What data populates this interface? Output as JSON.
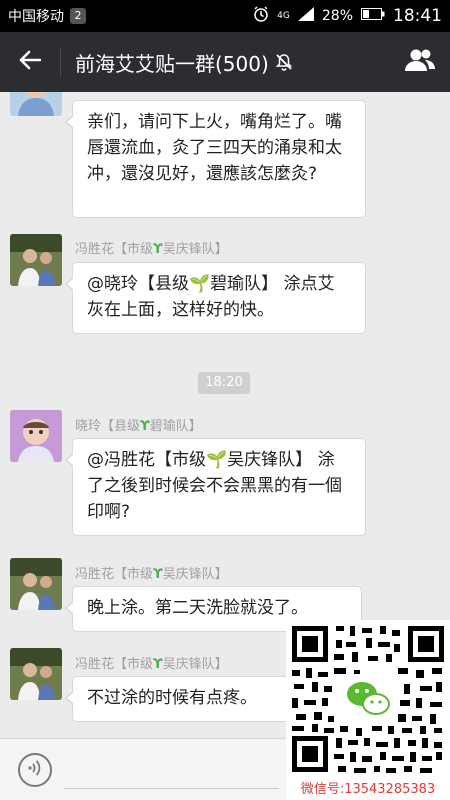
{
  "status_bar": {
    "carrier": "中国移动",
    "notification_count": "2",
    "network": "4G",
    "battery": "28%",
    "time": "18:41"
  },
  "header": {
    "title": "前海艾艾贴一群(500)"
  },
  "messages": [
    {
      "sender": "",
      "text": "亲们，请问下上火，嘴角烂了。嘴唇還流血，灸了三四天的涌泉和太冲，還沒见好，還應該怎麼灸?"
    },
    {
      "sender_name": "冯胜花",
      "sender_tag_a": "【市级",
      "sender_tag_b": "吴庆锋队】",
      "text": "@晓玲【县级🌱碧瑜队】 涂点艾灰在上面，这样好的快。"
    },
    {
      "sender_name": "晓玲",
      "sender_tag_a": "【县级",
      "sender_tag_b": "碧瑜队】",
      "text": "@冯胜花【市级🌱吴庆锋队】 涂了之後到时候会不会黑黑的有一個印啊?"
    },
    {
      "sender_name": "冯胜花",
      "sender_tag_a": "【市级",
      "sender_tag_b": "吴庆锋队】",
      "text": "晚上涂。第二天洗脸就没了。"
    },
    {
      "sender_name": "冯胜花",
      "sender_tag_a": "【市级",
      "sender_tag_b": "吴庆锋队】",
      "text": "不过涂的时候有点疼。"
    }
  ],
  "timestamp": "18:20",
  "overlay": {
    "caption": "微信号:13543285383"
  },
  "colors": {
    "header_bg": "#2b2d31",
    "chat_bg": "#ebebeb",
    "bubble_bg": "#ffffff",
    "sprout": "#4caf50",
    "caption": "#e53935"
  }
}
